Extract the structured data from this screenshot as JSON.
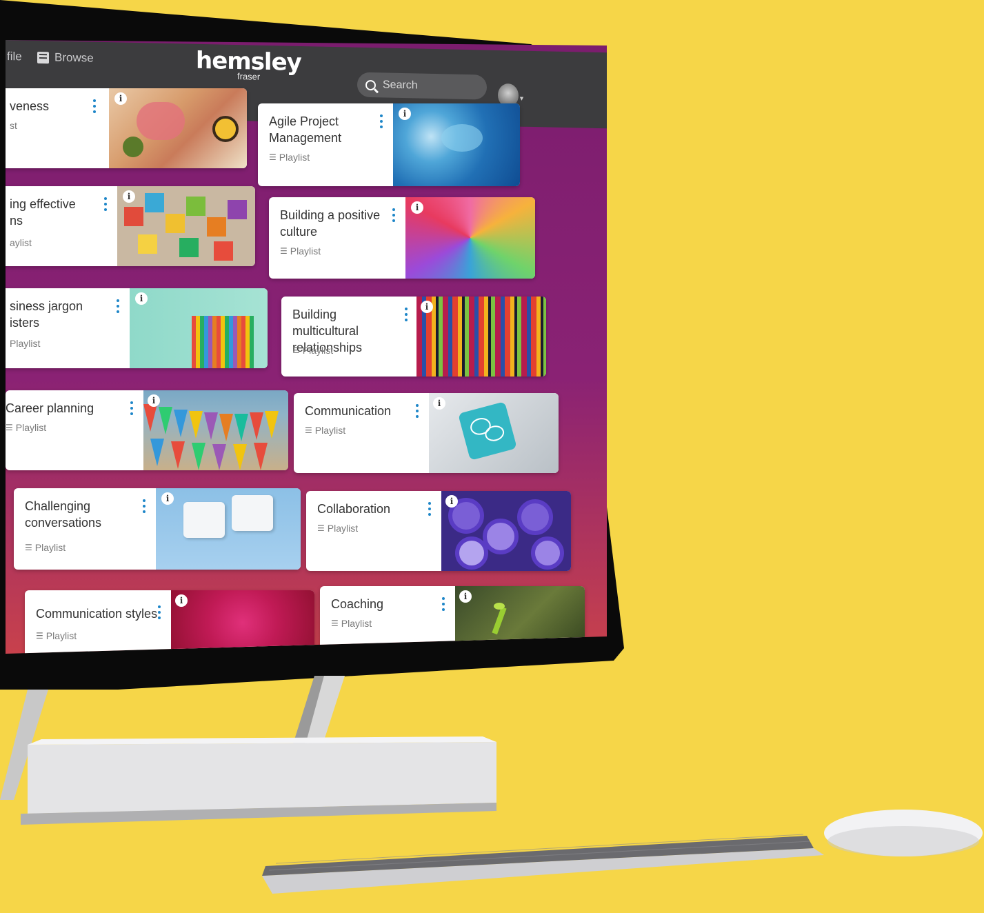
{
  "nav": {
    "profile_label": "file",
    "browse_label": "Browse",
    "logo_main": "hemsley",
    "logo_sub": "fraser",
    "search_placeholder": "Search"
  },
  "cards": [
    {
      "title": "veness",
      "type": "st"
    },
    {
      "title": "Agile Project Management",
      "type": "Playlist"
    },
    {
      "title": "ing effective ns",
      "type": "aylist"
    },
    {
      "title": "Building a positive culture",
      "type": "Playlist"
    },
    {
      "title": "siness jargon isters",
      "type": "Playlist"
    },
    {
      "title": "Building multicultural relationships",
      "type": "Playlist"
    },
    {
      "title": "Career planning",
      "type": "Playlist"
    },
    {
      "title": "Communication",
      "type": "Playlist"
    },
    {
      "title": "Challenging conversations",
      "type": "Playlist"
    },
    {
      "title": "Collaboration",
      "type": "Playlist"
    },
    {
      "title": "Communication styles",
      "type": "Playlist"
    },
    {
      "title": "Coaching",
      "type": "Playlist"
    }
  ],
  "colors": {
    "background": "#f6d648",
    "nav_bar": "#3c3c3e",
    "accent_purple": "#7b1d6e",
    "menu_dots": "#1e86c8"
  },
  "icons": {
    "browse": "archive-box-icon",
    "search": "search-icon",
    "list": "list-icon",
    "info": "info-icon",
    "menu": "vertical-dots-icon"
  }
}
